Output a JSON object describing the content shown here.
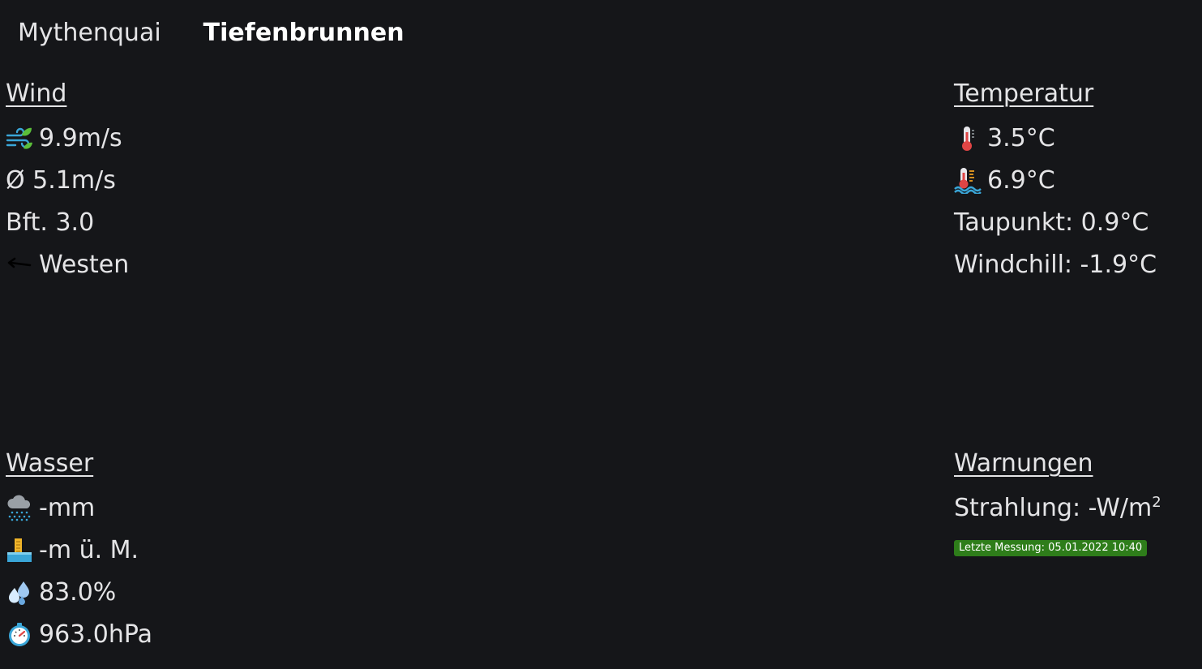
{
  "tabs": [
    {
      "label": "Mythenquai",
      "active": false
    },
    {
      "label": "Tiefenbrunnen",
      "active": true
    }
  ],
  "wind": {
    "title": "Wind",
    "speed": "9.9m/s",
    "avg": "Ø 5.1m/s",
    "beaufort": "Bft. 3.0",
    "direction": "Westen",
    "icons": [
      "wind-leaf-icon",
      "arrow-left-icon"
    ]
  },
  "temperature": {
    "title": "Temperatur",
    "air": "3.5°C",
    "water": "6.9°C",
    "dewpoint": "Taupunkt: 0.9°C",
    "windchill": "Windchill: -1.9°C",
    "icons": [
      "thermometer-icon",
      "water-thermometer-icon"
    ]
  },
  "water": {
    "title": "Wasser",
    "precipitation": "-mm",
    "level": "-m ü. M.",
    "humidity": "83.0%",
    "pressure": "963.0hPa",
    "icons": [
      "rain-cloud-icon",
      "water-level-icon",
      "droplets-icon",
      "barometer-icon"
    ]
  },
  "warnings": {
    "title": "Warnungen",
    "radiation_prefix": "Strahlung: -W/m",
    "radiation_sup": "2",
    "last_measurement": "Letzte Messung: 05.01.2022 10:40",
    "badge_color": "#2e7d1a"
  },
  "colors": {
    "background": "#151619",
    "text": "#e4e4e6"
  }
}
